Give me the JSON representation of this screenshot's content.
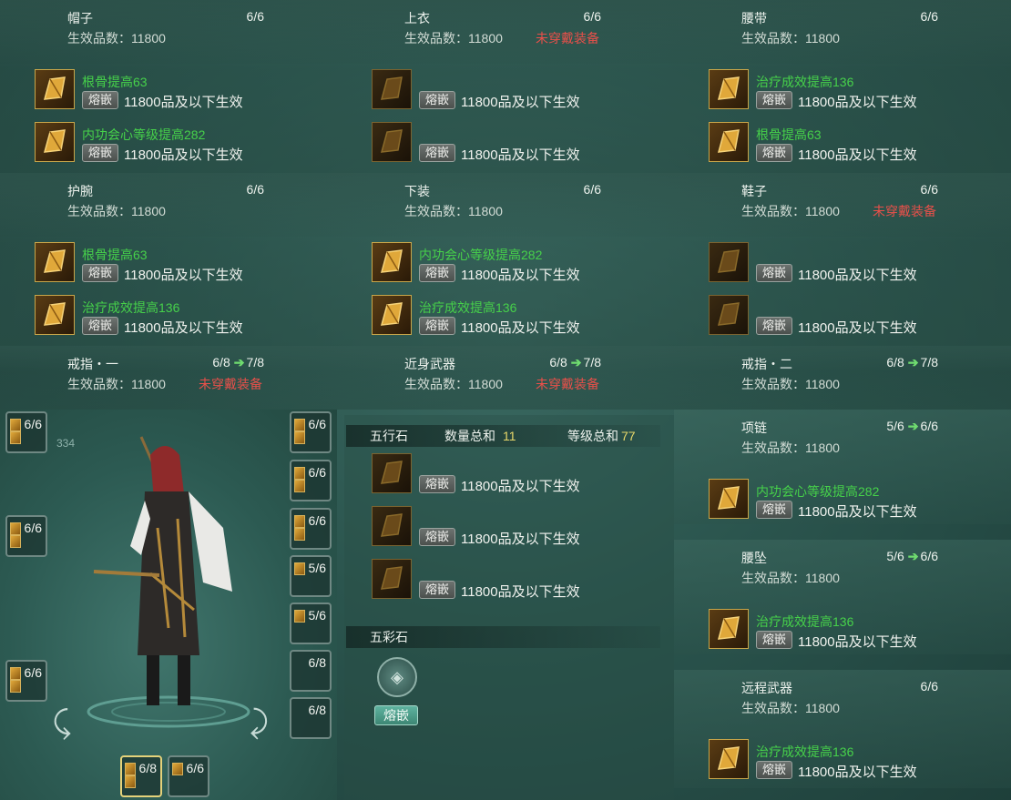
{
  "panels": [
    {
      "title": "帽子",
      "count": "6/6",
      "count_next": "",
      "quality": "生效品数：11800",
      "warning": "",
      "gems": [
        {
          "name": "根骨提高63",
          "dark": false,
          "inlay": "熔嵌",
          "text": "11800品及以下生效"
        },
        {
          "name": "内功会心等级提高282",
          "dark": false,
          "inlay": "熔嵌",
          "text": "11800品及以下生效"
        }
      ]
    },
    {
      "title": "上衣",
      "count": "6/6",
      "count_next": "",
      "quality": "生效品数：11800",
      "warning": "未穿戴装备",
      "gems": [
        {
          "name": "",
          "dark": true,
          "inlay": "熔嵌",
          "text": "11800品及以下生效"
        },
        {
          "name": "",
          "dark": true,
          "inlay": "熔嵌",
          "text": "11800品及以下生效"
        }
      ]
    },
    {
      "title": "腰带",
      "count": "6/6",
      "count_next": "",
      "quality": "生效品数：11800",
      "warning": "",
      "gems": [
        {
          "name": "治疗成效提高136",
          "dark": false,
          "inlay": "熔嵌",
          "text": "11800品及以下生效"
        },
        {
          "name": "根骨提高63",
          "dark": false,
          "inlay": "熔嵌",
          "text": "11800品及以下生效"
        }
      ]
    },
    {
      "title": "护腕",
      "count": "6/6",
      "count_next": "",
      "quality": "生效品数：11800",
      "warning": "",
      "gems": [
        {
          "name": "根骨提高63",
          "dark": false,
          "inlay": "熔嵌",
          "text": "11800品及以下生效"
        },
        {
          "name": "治疗成效提高136",
          "dark": false,
          "inlay": "熔嵌",
          "text": "11800品及以下生效"
        }
      ]
    },
    {
      "title": "下装",
      "count": "6/6",
      "count_next": "",
      "quality": "生效品数：11800",
      "warning": "",
      "gems": [
        {
          "name": "内功会心等级提高282",
          "dark": false,
          "inlay": "熔嵌",
          "text": "11800品及以下生效"
        },
        {
          "name": "治疗成效提高136",
          "dark": false,
          "inlay": "熔嵌",
          "text": "11800品及以下生效"
        }
      ]
    },
    {
      "title": "鞋子",
      "count": "6/6",
      "count_next": "",
      "quality": "生效品数：11800",
      "warning": "未穿戴装备",
      "gems": [
        {
          "name": "",
          "dark": true,
          "inlay": "熔嵌",
          "text": "11800品及以下生效"
        },
        {
          "name": "",
          "dark": true,
          "inlay": "熔嵌",
          "text": "11800品及以下生效"
        }
      ]
    },
    {
      "title": "戒指・一",
      "count": "6/8",
      "count_next": "7/8",
      "quality": "生效品数：11800",
      "warning": "未穿戴装备",
      "gems": []
    },
    {
      "title": "近身武器",
      "count": "6/8",
      "count_next": "7/8",
      "quality": "生效品数：11800",
      "warning": "未穿戴装备",
      "gems": []
    },
    {
      "title": "戒指・二",
      "count": "6/8",
      "count_next": "7/8",
      "quality": "生效品数：11800",
      "warning": "",
      "gems": []
    }
  ],
  "right_panels": [
    {
      "title": "项链",
      "count": "5/6",
      "count_next": "6/6",
      "quality": "生效品数：11800",
      "gem": {
        "name": "内功会心等级提高282",
        "inlay": "熔嵌",
        "text": "11800品及以下生效"
      }
    },
    {
      "title": "腰坠",
      "count": "5/6",
      "count_next": "6/6",
      "quality": "生效品数：11800",
      "gem": {
        "name": "治疗成效提高136",
        "inlay": "熔嵌",
        "text": "11800品及以下生效"
      }
    },
    {
      "title": "远程武器",
      "count": "6/6",
      "count_next": "",
      "quality": "生效品数：11800",
      "gem": {
        "name": "治疗成效提高136",
        "inlay": "熔嵌",
        "text": "11800品及以下生效"
      }
    }
  ],
  "wuxing": {
    "title": "五行石",
    "qty_label": "数量总和",
    "qty": "11",
    "lvl_label": "等级总和",
    "lvl": "77",
    "rows": [
      {
        "inlay": "熔嵌",
        "text": "11800品及以下生效"
      },
      {
        "inlay": "熔嵌",
        "text": "11800品及以下生效"
      },
      {
        "inlay": "熔嵌",
        "text": "11800品及以下生效"
      }
    ]
  },
  "wucai": {
    "title": "五彩石",
    "button": "熔嵌"
  },
  "char_faint": "334",
  "equip_slots_left": [
    "6/6",
    "6/6",
    "6/6"
  ],
  "equip_slots_right": [
    "6/6",
    "6/6",
    "6/6",
    "5/6",
    "5/6",
    "6/8",
    "6/8"
  ],
  "equip_slots_bottom": [
    "6/8",
    "6/6"
  ]
}
